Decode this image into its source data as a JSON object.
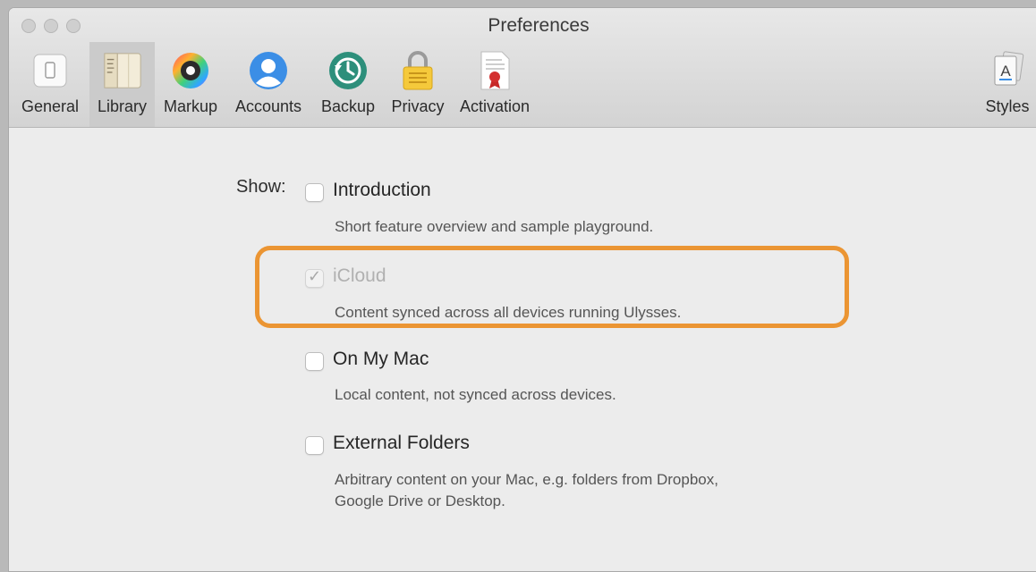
{
  "window": {
    "title": "Preferences"
  },
  "toolbar": {
    "items": [
      {
        "label": "General",
        "icon": "general-icon"
      },
      {
        "label": "Library",
        "icon": "library-icon",
        "selected": true
      },
      {
        "label": "Markup",
        "icon": "markup-icon"
      },
      {
        "label": "Accounts",
        "icon": "accounts-icon"
      },
      {
        "label": "Backup",
        "icon": "backup-icon"
      },
      {
        "label": "Privacy",
        "icon": "privacy-icon"
      },
      {
        "label": "Activation",
        "icon": "activation-icon"
      },
      {
        "label": "Styles",
        "icon": "styles-icon"
      }
    ]
  },
  "library": {
    "show_label": "Show:",
    "options": [
      {
        "title": "Introduction",
        "description": [
          "Short feature overview and sample playground."
        ],
        "checked": false,
        "enabled": true
      },
      {
        "title": "iCloud",
        "description": [
          "Content synced across all devices running Ulysses."
        ],
        "checked": true,
        "enabled": false
      },
      {
        "title": "On My Mac",
        "description": [
          "Local content, not synced across devices."
        ],
        "checked": false,
        "enabled": true
      },
      {
        "title": "External Folders",
        "description": [
          "Arbitrary content on your Mac, e.g. folders from Dropbox,",
          "Google Drive or Desktop."
        ],
        "checked": false,
        "enabled": true
      }
    ]
  },
  "colors": {
    "highlight": "#eb9533",
    "selected_tab": "#cbcbcb"
  }
}
